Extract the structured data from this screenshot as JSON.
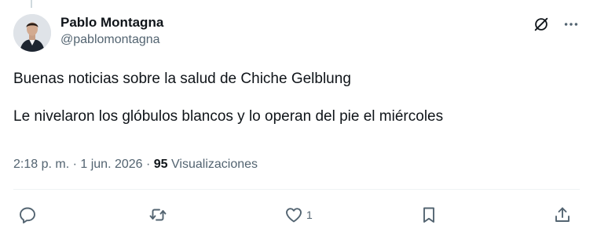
{
  "author": {
    "name": "Pablo Montagna",
    "handle": "@pablomontagna"
  },
  "tweet": {
    "paragraphs": [
      "Buenas noticias sobre la salud de Chiche Gelblung",
      "Le nivelaron los glóbulos blancos y lo operan del pie el miércoles"
    ]
  },
  "meta": {
    "time": "2:18 p. m.",
    "separator": " · ",
    "date": "1 jun. 2026",
    "views_count": "95",
    "views_label": "Visualizaciones"
  },
  "actions": {
    "like_count": "1"
  },
  "icons": {
    "top_right": [
      "grok-icon",
      "more-options-icon"
    ],
    "action_bar": [
      "reply-icon",
      "retweet-icon",
      "like-icon",
      "bookmark-icon",
      "share-icon"
    ]
  },
  "colors": {
    "text_primary": "#0f1419",
    "text_secondary": "#536471",
    "divider": "#eff3f4"
  }
}
